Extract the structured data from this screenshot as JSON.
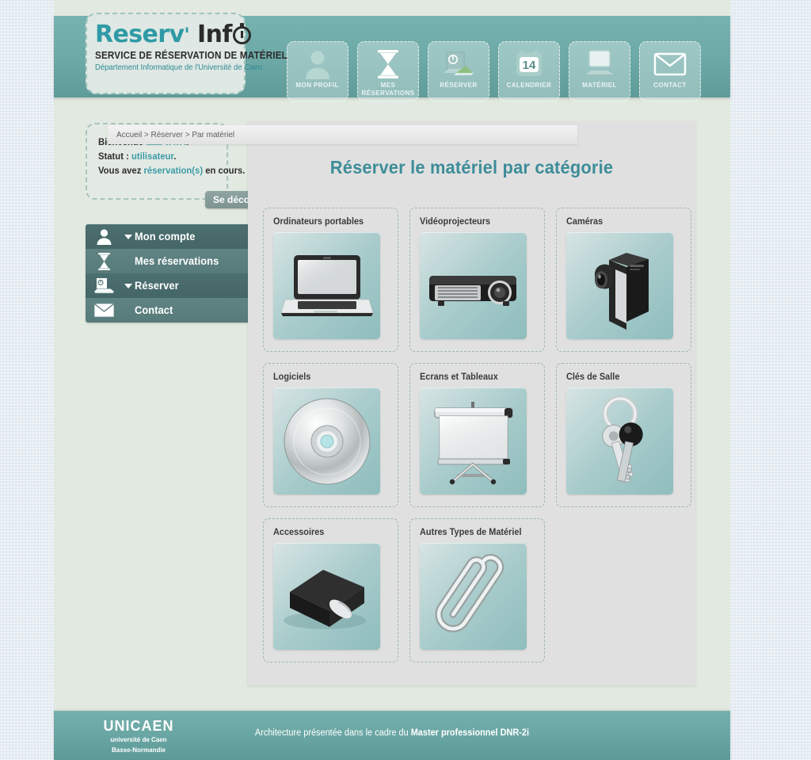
{
  "brand": {
    "name_part1": "Reserv",
    "apostrophe": "'",
    "name_part2": "Inf",
    "clock_icon": "stopwatch-icon",
    "tagline": "SERVICE DE RÉSERVATION DE MATÉRIEL",
    "subtitle": "Département Informatique de l'Université de Caen"
  },
  "topnav": [
    {
      "label": "Mon profil",
      "icon": "user-icon"
    },
    {
      "label": "Mes réservations",
      "icon": "hourglass-icon"
    },
    {
      "label": "Réserver",
      "icon": "laptop-book-icon"
    },
    {
      "label": "Calendrier",
      "icon": "calendar-icon",
      "day": "14"
    },
    {
      "label": "Matériel",
      "icon": "monitor-icon"
    },
    {
      "label": "Contact",
      "icon": "envelope-icon"
    }
  ],
  "welcome": {
    "line1_prefix": "Bienvenue ",
    "line1_user": "tata TATA",
    "line1_suffix": ".",
    "line2_prefix": "Statut : ",
    "line2_value": "utilisateur",
    "line2_suffix": ".",
    "line3_prefix": "Vous avez ",
    "line3_value": "réservation(s)",
    "line3_suffix": " en cours.",
    "logout_label": "Se déconnecter"
  },
  "sidemenu": [
    {
      "label": "Mon compte",
      "icon": "user-icon",
      "has_arrow": true
    },
    {
      "label": "Mes réservations",
      "icon": "hourglass-icon",
      "has_arrow": false
    },
    {
      "label": "Réserver",
      "icon": "laptop-book-icon",
      "has_arrow": true
    },
    {
      "label": "Contact",
      "icon": "envelope-icon",
      "has_arrow": false
    }
  ],
  "main": {
    "breadcrumb": "Accueil > Réserver > Par matériel",
    "title": "Réserver le matériel par catégorie"
  },
  "categories": [
    {
      "label": "Ordinateurs portables",
      "icon": "laptop-icon"
    },
    {
      "label": "Vidéoprojecteurs",
      "icon": "projector-icon"
    },
    {
      "label": "Caméras",
      "icon": "camcorder-icon"
    },
    {
      "label": "Logiciels",
      "icon": "cd-disc-icon"
    },
    {
      "label": "Ecrans et Tableaux",
      "icon": "projection-screen-icon"
    },
    {
      "label": "Clés de Salle",
      "icon": "keys-icon"
    },
    {
      "label": "Accessoires",
      "icon": "black-box-icon"
    },
    {
      "label": "Autres Types de Matériel",
      "icon": "paperclip-icon"
    }
  ],
  "footer": {
    "logo_main": "UNICAEN",
    "logo_sub_line1": "université de Caen",
    "logo_sub_line2": "Basse-Normandie",
    "text_prefix": "Architecture présentée dans le cadre du ",
    "text_bold": "Master professionnel DNR-2i"
  },
  "colors": {
    "teal_band": "#6da9a6",
    "accent_text": "#3d9ba8",
    "title": "#3d8d99",
    "menu_dark": "#4c6f70",
    "menu_light": "#5f8483",
    "page_bg": "#e2e9e0",
    "content_bg": "#e0e0e0"
  }
}
